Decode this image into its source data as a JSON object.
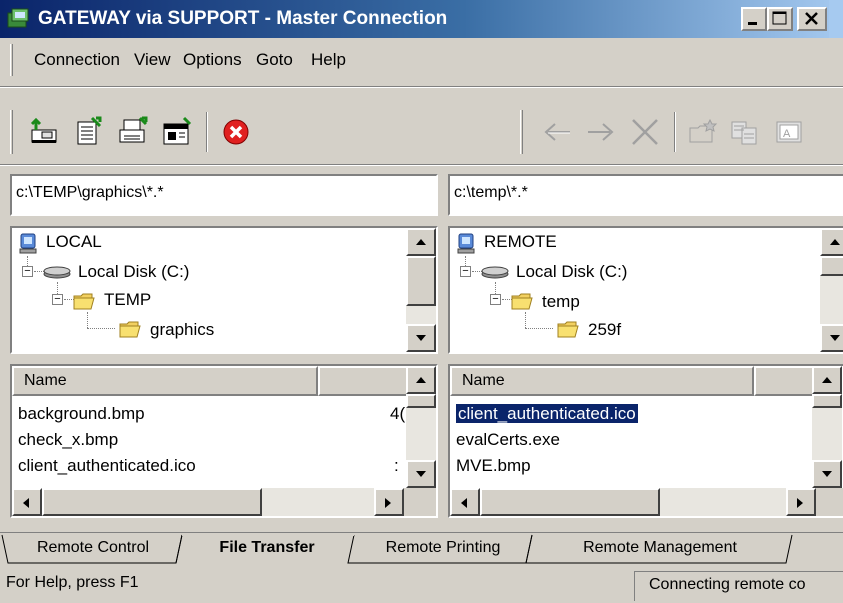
{
  "window": {
    "title": "GATEWAY via SUPPORT - Master Connection",
    "buttons": [
      "minimize",
      "maximize",
      "close"
    ]
  },
  "menu": {
    "items": [
      {
        "label": "Connection"
      },
      {
        "label": "View"
      },
      {
        "label": "Options"
      },
      {
        "label": "Goto"
      },
      {
        "label": "Help"
      }
    ]
  },
  "toolbar": {
    "left_icons": [
      "connect-icon",
      "transfer-icon",
      "print-icon",
      "properties-icon",
      "stop-icon"
    ],
    "right_icons": [
      "back-arrow-icon",
      "forward-arrow-icon",
      "delete-x-icon",
      "new-folder-icon",
      "copy-icon",
      "rename-icon"
    ]
  },
  "local": {
    "path": "c:\\TEMP\\graphics\\*.*",
    "tree": {
      "root": "LOCAL",
      "disk": "Local Disk (C:)",
      "folder": "TEMP",
      "subfolder": "graphics"
    },
    "list": {
      "header_name": "Name",
      "files": [
        {
          "name": "background.bmp",
          "extra": "4("
        },
        {
          "name": "check_x.bmp",
          "extra": ""
        },
        {
          "name": "client_authenticated.ico",
          "extra": ":"
        }
      ]
    }
  },
  "remote": {
    "path": "c:\\temp\\*.*",
    "tree": {
      "root": "REMOTE",
      "disk": "Local Disk (C:)",
      "folder": "temp",
      "subfolder": "259f"
    },
    "list": {
      "header_name": "Name",
      "files": [
        {
          "name": "client_authenticated.ico",
          "selected": true
        },
        {
          "name": "evalCerts.exe",
          "selected": false
        },
        {
          "name": "MVE.bmp",
          "selected": false
        }
      ]
    }
  },
  "tabs": [
    {
      "label": "Remote Control",
      "active": false
    },
    {
      "label": "File Transfer",
      "active": true
    },
    {
      "label": "Remote Printing",
      "active": false
    },
    {
      "label": "Remote Management",
      "active": false
    }
  ],
  "status": {
    "left": "For Help, press F1",
    "right": "Connecting remote co"
  },
  "colors": {
    "titlebar_start": "#0a246a",
    "titlebar_end": "#a6caf0",
    "face": "#d4d0c8",
    "selection": "#0a246a"
  }
}
